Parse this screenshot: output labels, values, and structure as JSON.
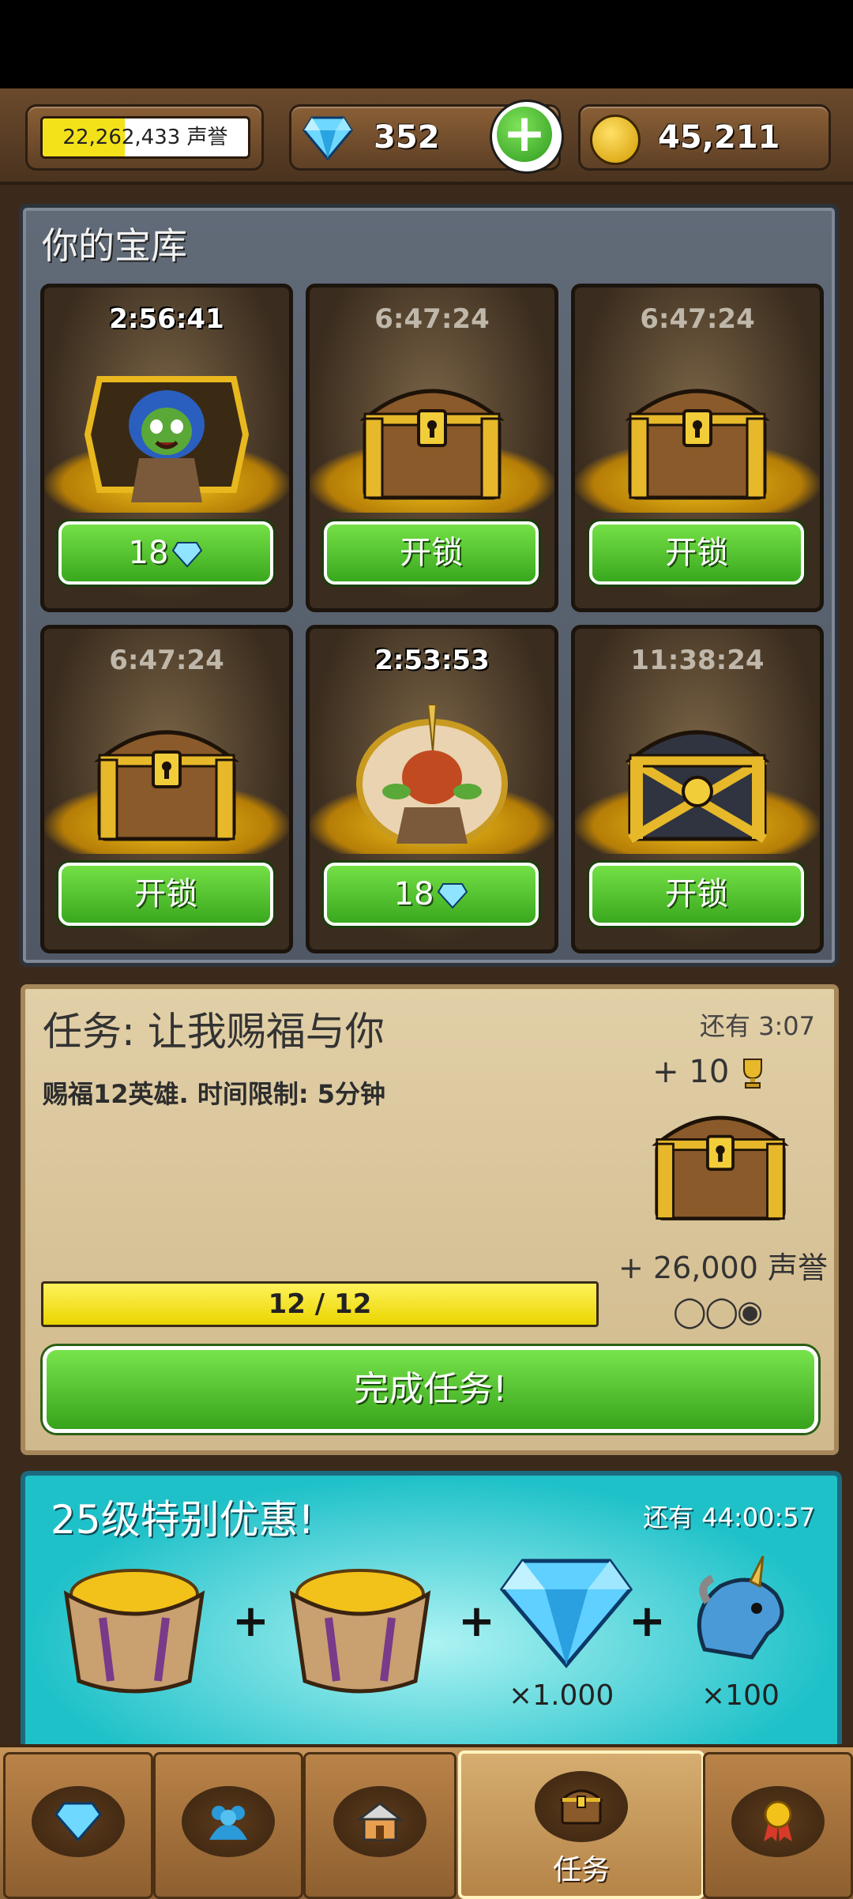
{
  "header": {
    "reputation": "22,262,433 声誉",
    "reputation_progress": 0.4,
    "gems": "352",
    "add_label": "+",
    "gold": "45,211"
  },
  "vault": {
    "title": "你的宝库",
    "slots": [
      {
        "timer": "2:56:41",
        "button": "18",
        "active": true,
        "content": "goblin-hooded"
      },
      {
        "timer": "6:47:24",
        "button": "开锁",
        "active": false,
        "content": "wooden-chest"
      },
      {
        "timer": "6:47:24",
        "button": "开锁",
        "active": false,
        "content": "wooden-chest"
      },
      {
        "timer": "6:47:24",
        "button": "开锁",
        "active": false,
        "content": "wooden-chest"
      },
      {
        "timer": "2:53:53",
        "button": "18",
        "active": true,
        "content": "goblin-unicorn"
      },
      {
        "timer": "11:38:24",
        "button": "开锁",
        "active": false,
        "content": "iron-chest"
      }
    ]
  },
  "quest": {
    "title": "任务: 让我赐福与你",
    "remaining": "还有 3:07",
    "description": "赐福12英雄. 时间限制: 5分钟",
    "reward_trophies": "+ 10",
    "reward_reputation": "+ 26,000 声誉",
    "progress_label": "12 / 12",
    "progress": 1.0,
    "stage_dots": "◯◯◉",
    "complete_button": "完成任务!"
  },
  "offer": {
    "title": "25级特别优惠!",
    "remaining": "还有 44:00:57",
    "plus": "+",
    "gem_qty": "×1.000",
    "unicorn_qty": "×100"
  },
  "tabs": [
    {
      "icon": "gem-icon",
      "label": ""
    },
    {
      "icon": "heroes-icon",
      "label": ""
    },
    {
      "icon": "buildings-icon",
      "label": ""
    },
    {
      "icon": "chest-icon",
      "label": "任务",
      "active": true
    },
    {
      "icon": "medal-icon",
      "label": ""
    }
  ],
  "colors": {
    "accent_green": "#4cc52a",
    "progress_yellow": "#f0e000",
    "offer_teal": "#1fc1c9"
  }
}
